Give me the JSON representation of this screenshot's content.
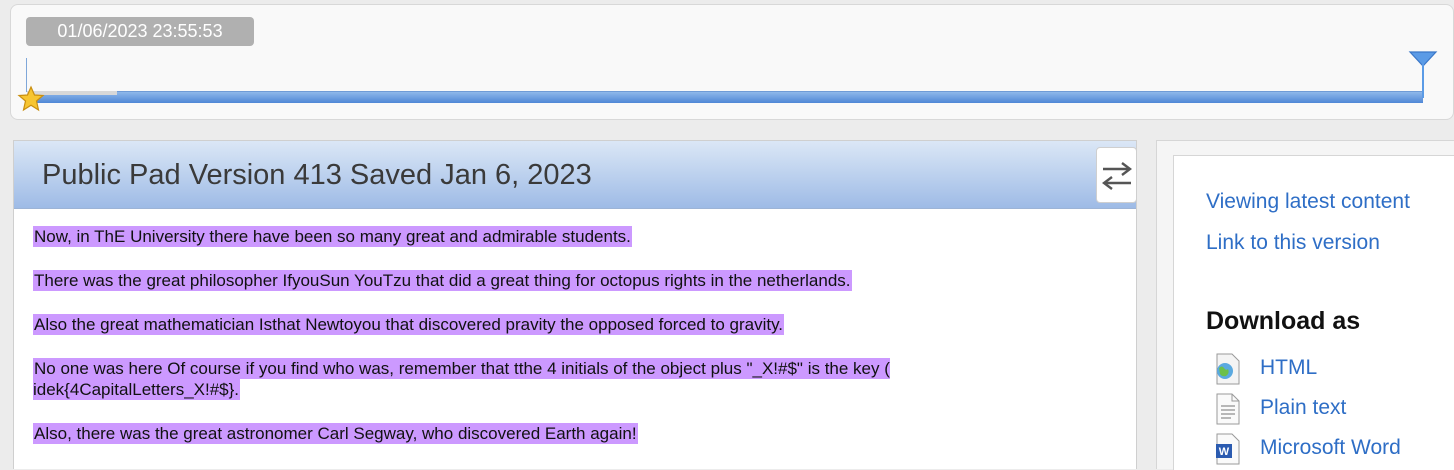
{
  "timeslider": {
    "timestamp": "01/06/2023 23:55:53",
    "position_fraction": 1.0
  },
  "editor": {
    "title": "Public Pad Version 413 Saved Jan 6, 2023",
    "swap_icon": "swap-arrows-icon",
    "highlight_color": "#cc99ff",
    "lines": [
      "Now, in ThE University there have been so many great and admirable students.",
      "There was the great philosopher IfyouSun YouTzu that did a great thing for octopus rights in the netherlands.",
      "Also the great mathematician Isthat Newtoyou that discovered pravity the opposed forced to gravity.",
      "No one was here Of course if you find who was, remember that tthe   4 initials of the object plus  \"_X!#$\" is the key ( idek{4CapitalLetters_X!#$}.",
      "Also, there was the great astronomer Carl Segway, who discovered Earth again!"
    ]
  },
  "sidebar": {
    "viewing_latest": "Viewing latest content",
    "link_version": "Link to this version",
    "download_heading": "Download as",
    "downloads": [
      {
        "label": "HTML",
        "icon": "html-globe-icon"
      },
      {
        "label": "Plain text",
        "icon": "text-file-icon"
      },
      {
        "label": "Microsoft Word",
        "icon": "word-file-icon"
      }
    ]
  },
  "colors": {
    "accent": "#2e6ec6",
    "header_gradient_top": "#dbe7f6",
    "header_gradient_bottom": "#9ebbe6",
    "track": "#4f87d6"
  }
}
